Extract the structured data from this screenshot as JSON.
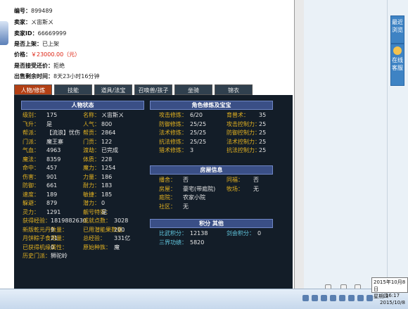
{
  "seller": {
    "id_label": "编号：",
    "id_value": "899489",
    "seller_label": "卖家：",
    "seller_value": "ㄨ宙斯ㄨ",
    "sellerid_label": "卖家ID：",
    "sellerid_value": "66669999",
    "listed_label": "是否上架：",
    "listed_value": "已上架",
    "price_label": "价格：",
    "price_value": "￥23000.00（元）",
    "counter_label": "是否接受还价：",
    "counter_value": "拒绝",
    "remain_label": "出售剩余时间：",
    "remain_value": "8天23小时16分钟"
  },
  "tabs": [
    "人物/修炼",
    "技能",
    "道具/法宝",
    "召唤兽/孩子",
    "坐骑",
    "锦衣"
  ],
  "sections": {
    "status": "人物状态",
    "cultivation": "角色修炼及宝宝",
    "house": "房屋信息",
    "points": "积分  其他"
  },
  "status": [
    {
      "l": "级别：",
      "v": "175",
      "l2": "名称：",
      "v2": "ㄨ宙斯ㄨ"
    },
    {
      "l": "飞升：",
      "v": "是",
      "l2": "人气：",
      "v2": "800"
    },
    {
      "l": "帮派：",
      "v": "【流浪】忧伤",
      "l2": "帮贡：",
      "v2": "2864"
    },
    {
      "l": "门派：",
      "v": "魔王寨",
      "l2": "门贡：",
      "v2": "122"
    },
    {
      "l": "气血：",
      "v": "4963",
      "l2": "渡劫：",
      "v2": "已完成"
    },
    {
      "l": "魔法：",
      "v": "8359",
      "l2": "体质：",
      "v2": "228"
    },
    {
      "l": "命中：",
      "v": "457",
      "l2": "魔力：",
      "v2": "1254"
    },
    {
      "l": "伤害：",
      "v": "901",
      "l2": "力量：",
      "v2": "186"
    },
    {
      "l": "防御：",
      "v": "661",
      "l2": "耐力：",
      "v2": "183"
    },
    {
      "l": "速度：",
      "v": "189",
      "l2": "敏捷：",
      "v2": "185"
    },
    {
      "l": "躲避：",
      "v": "879",
      "l2": "潜力：",
      "v2": "0"
    },
    {
      "l": "灵力：",
      "v": "1291",
      "l2": "靓号特效：",
      "v2": "是"
    }
  ],
  "status_extra": [
    {
      "l": "获得经验：",
      "v": "1819882630",
      "l2": "成就点数：",
      "v2": "3028"
    },
    {
      "l": "新版乾元丹数量：",
      "v": "9",
      "l2": "已用潜能果数量：",
      "v2": "200"
    },
    {
      "l": "月饼粽子食用量：",
      "v": "21",
      "l2": "总经验：",
      "v2": "331亿"
    },
    {
      "l": "已获得机缘属性：",
      "v": "0",
      "l2": "原始种族：",
      "v2": "魔"
    },
    {
      "l": "历史门派：",
      "v": "狮驼岭",
      "l2": "",
      "v2": ""
    }
  ],
  "cultivation": [
    {
      "l": "攻击修炼：",
      "v": "6/20",
      "l2": "育兽术：",
      "v2": "35"
    },
    {
      "l": "防御修炼：",
      "v": "25/25",
      "l2": "攻击控制力：",
      "v2": "25"
    },
    {
      "l": "法术修炼：",
      "v": "25/25",
      "l2": "防御控制力：",
      "v2": "25"
    },
    {
      "l": "抗法修炼：",
      "v": "25/25",
      "l2": "法术控制力：",
      "v2": "25"
    },
    {
      "l": "猎术修炼：",
      "v": "3",
      "l2": "抗法控制力：",
      "v2": "25"
    }
  ],
  "house": [
    {
      "l": "播舍：",
      "v": "否",
      "l2": "同福：",
      "v2": "否"
    },
    {
      "l": "房屋：",
      "v": "豪宅(带庭院)",
      "l2": "牧场：",
      "v2": "无"
    },
    {
      "l": "庭院：",
      "v": "农家小院",
      "l2": "",
      "v2": ""
    },
    {
      "l": "社区：",
      "v": "无",
      "l2": "",
      "v2": ""
    }
  ],
  "points": [
    {
      "l": "比武积分：",
      "v": "12138",
      "l2": "剑会积分：",
      "v2": "0"
    },
    {
      "l": "三界功绩：",
      "v": "5820",
      "l2": "",
      "v2": ""
    }
  ],
  "side": {
    "btn1": "最近浏览",
    "btn2": "在线客服"
  },
  "taskbar": {
    "time": "16:17",
    "date": "2015/10/8",
    "tooltip_date": "2015年10月8日",
    "tooltip_day": "星期四"
  }
}
